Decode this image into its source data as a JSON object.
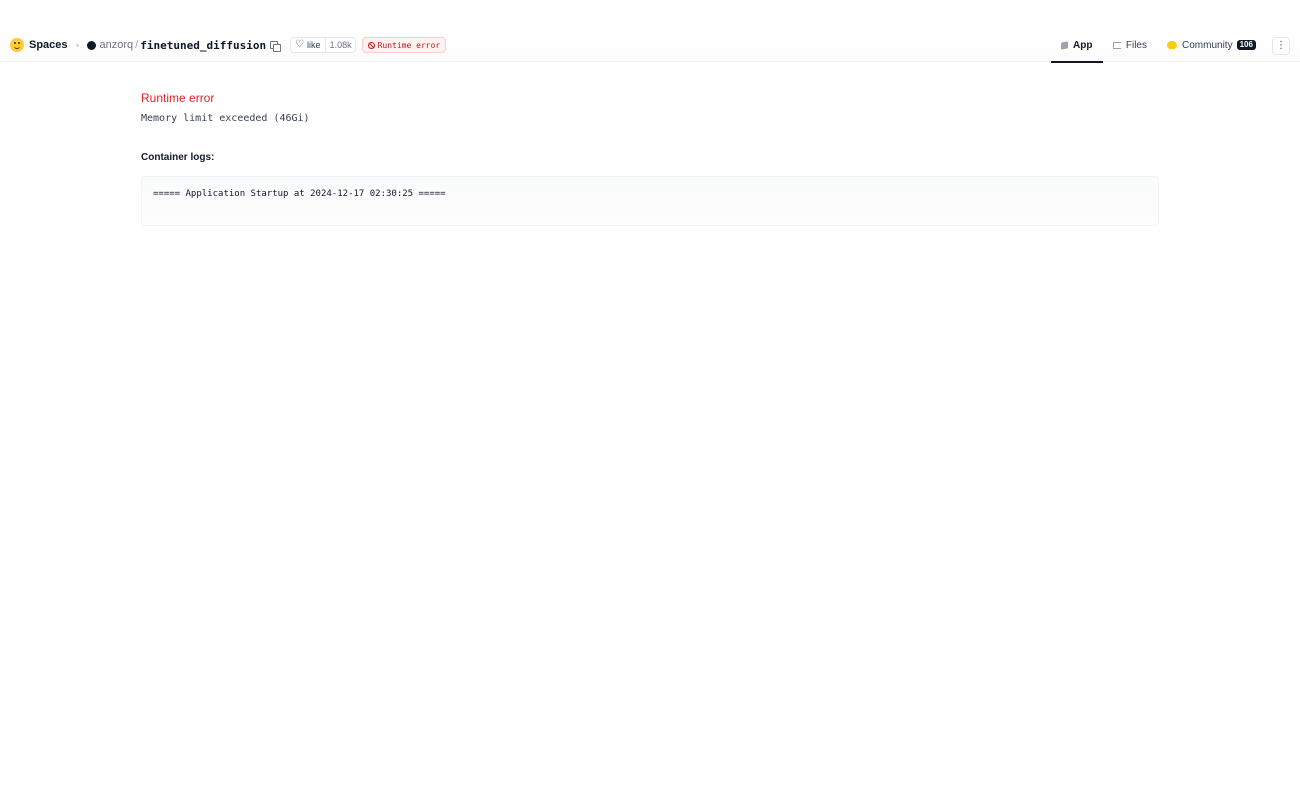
{
  "header": {
    "spaces_label": "Spaces",
    "owner": "anzorq",
    "slash": "/",
    "repo": "finetuned_diffusion",
    "like_label": "like",
    "like_count": "1.08k",
    "status": "Runtime error",
    "tabs": [
      {
        "label": "App",
        "icon": "cube-icon",
        "active": true
      },
      {
        "label": "Files",
        "icon": "files-icon",
        "active": false
      },
      {
        "label": "Community",
        "icon": "community-icon",
        "active": false,
        "count": "106"
      }
    ],
    "more_glyph": "⋮"
  },
  "main": {
    "error_title": "Runtime error",
    "error_message": "Memory limit exceeded (46Gi)",
    "logs_label": "Container logs:",
    "log_lines": [
      "===== Application Startup at 2024-12-17 02:30:25 ====="
    ]
  },
  "colors": {
    "error": "#dc2626",
    "badge_bg": "#fef2f2",
    "badge_text": "#b91c1c",
    "brand_yellow": "#ffcc33"
  }
}
